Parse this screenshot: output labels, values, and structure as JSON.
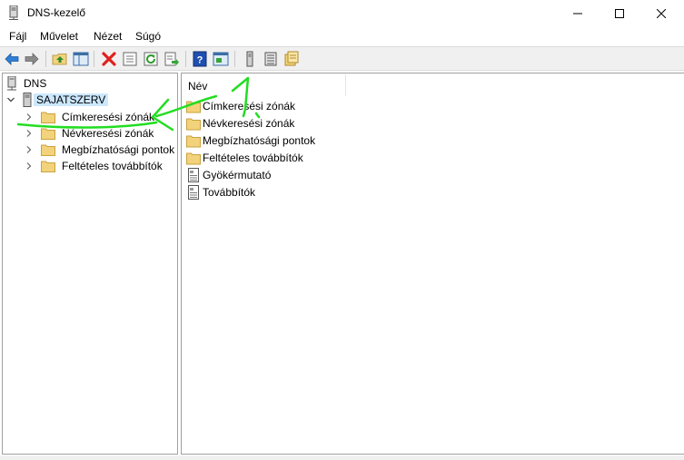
{
  "window": {
    "title": "DNS-kezelő",
    "icon": "dns-server-icon",
    "controls": [
      "minimize-icon",
      "maximize-icon",
      "close-icon"
    ]
  },
  "menu": {
    "items": [
      {
        "label": "Fájl"
      },
      {
        "label": "Művelet"
      },
      {
        "label": "Nézet"
      },
      {
        "label": "Súgó"
      }
    ]
  },
  "toolbar": {
    "buttons": [
      "back-icon",
      "forward-icon",
      "up-folder-icon",
      "show-hide-tree-icon",
      "delete-icon",
      "properties-icon",
      "refresh-icon",
      "export-list-icon",
      "help-icon",
      "console-view-icon",
      "server-icon",
      "list-icon",
      "folder-new-icon"
    ]
  },
  "tree": {
    "root": "DNS",
    "server": "SAJATSZERV",
    "children": [
      {
        "label": "Címkeresési zónák"
      },
      {
        "label": "Névkeresési zónák"
      },
      {
        "label": "Megbízhatósági pontok"
      },
      {
        "label": "Feltételes továbbítók"
      }
    ]
  },
  "list": {
    "column_header": "Név",
    "items": [
      {
        "label": "Címkeresési zónák",
        "icon": "folder-icon"
      },
      {
        "label": "Névkeresési zónák",
        "icon": "folder-icon"
      },
      {
        "label": "Megbízhatósági pontok",
        "icon": "folder-icon"
      },
      {
        "label": "Feltételes továbbítók",
        "icon": "folder-icon"
      },
      {
        "label": "Gyökérmutató",
        "icon": "document-icon"
      },
      {
        "label": "Továbbítók",
        "icon": "document-icon"
      }
    ]
  },
  "colors": {
    "selection": "#cce8ff",
    "annotation": "#22dd22",
    "folder": "#f2d27a",
    "delete": "#e0211d"
  }
}
